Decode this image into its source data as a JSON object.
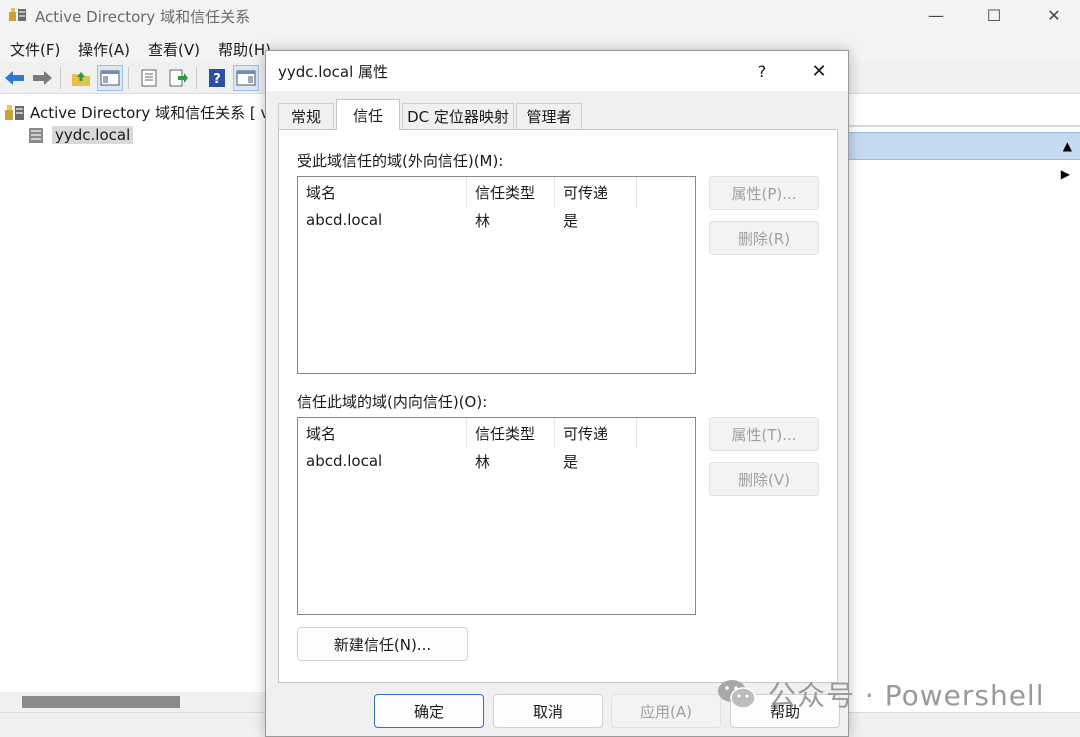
{
  "window": {
    "title": "Active Directory 域和信任关系",
    "minimize": "—",
    "maximize": "☐",
    "close": "✕"
  },
  "menu": {
    "items": [
      "文件(F)",
      "操作(A)",
      "查看(V)",
      "帮助(H)"
    ]
  },
  "tree": {
    "root_label": "Active Directory 域和信任关系 [ vdc",
    "child_label": "yydc.local"
  },
  "dialog": {
    "title": "yydc.local 属性",
    "help": "?",
    "close": "✕",
    "tabs": [
      "常规",
      "信任",
      "DC 定位器映射",
      "管理者"
    ],
    "active_tab": "信任",
    "outgoing": {
      "label": "受此域信任的域(外向信任)(M):",
      "columns": [
        "域名",
        "信任类型",
        "可传递"
      ],
      "rows": [
        [
          "abcd.local",
          "林",
          "是"
        ]
      ],
      "properties_button": "属性(P)...",
      "remove_button": "删除(R)"
    },
    "incoming": {
      "label": "信任此域的域(内向信任)(O):",
      "columns": [
        "域名",
        "信任类型",
        "可传递"
      ],
      "rows": [
        [
          "abcd.local",
          "林",
          "是"
        ]
      ],
      "properties_button": "属性(T)...",
      "remove_button": "删除(V)"
    },
    "new_trust_button": "新建信任(N)...",
    "ok_button": "确定",
    "cancel_button": "取消",
    "apply_button": "应用(A)",
    "help_button": "帮助"
  },
  "watermark": {
    "text": "公众号 · Powershell"
  },
  "colors": {
    "accent": "#2f6fd6",
    "selection_band": "#c5d9f1",
    "dialog_bg": "#f0f0f0"
  }
}
